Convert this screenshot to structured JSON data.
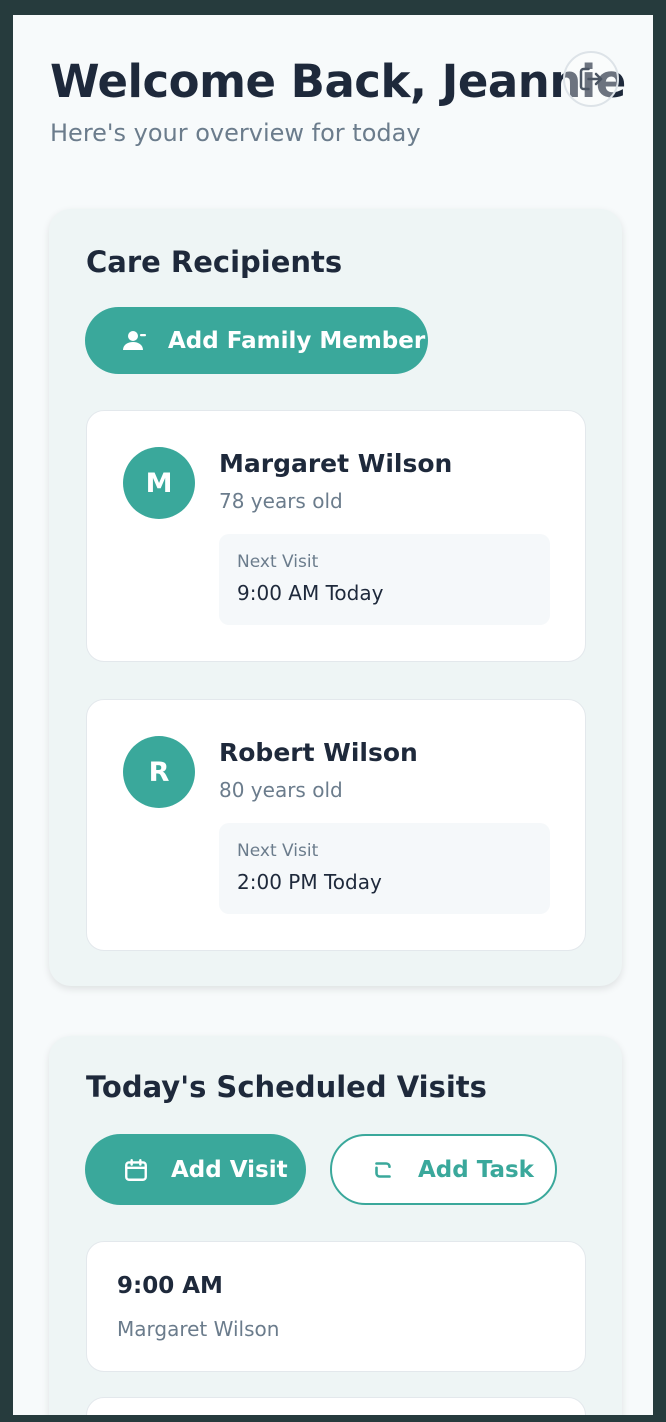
{
  "header": {
    "title": "Welcome Back, Jeannie",
    "subtitle": "Here's your overview for today",
    "logout_icon": "logout-icon"
  },
  "recipients": {
    "title": "Care Recipients",
    "add_button_label": "Add Family Member",
    "add_button_icon": "person-add-icon",
    "items": [
      {
        "initial": "M",
        "name": "Margaret Wilson",
        "age": "78 years old",
        "next_visit_label": "Next Visit",
        "next_visit_value": "9:00 AM Today"
      },
      {
        "initial": "R",
        "name": "Robert Wilson",
        "age": "80 years old",
        "next_visit_label": "Next Visit",
        "next_visit_value": "2:00 PM Today"
      }
    ]
  },
  "visits": {
    "title": "Today's Scheduled Visits",
    "add_visit_label": "Add Visit",
    "add_visit_icon": "calendar-icon",
    "add_task_label": "Add Task",
    "add_task_icon": "task-icon",
    "items": [
      {
        "time": "9:00 AM",
        "name": "Margaret Wilson"
      }
    ]
  },
  "colors": {
    "accent": "#3aa89b",
    "text_primary": "#1e293b",
    "text_secondary": "#6b7c8c",
    "frame": "#263b3d"
  }
}
